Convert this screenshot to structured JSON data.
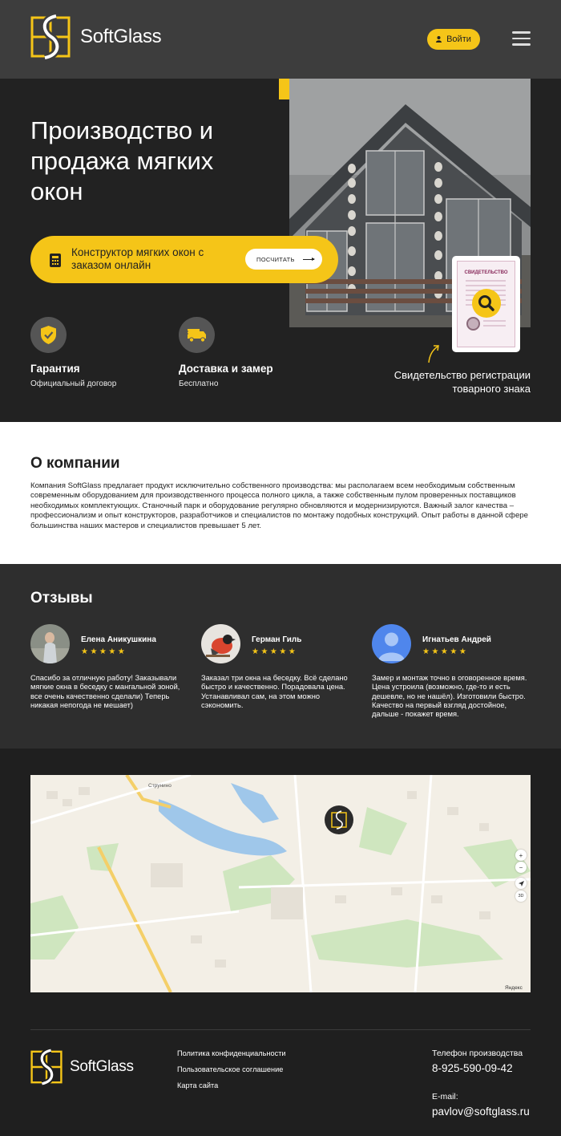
{
  "header": {
    "brand": "SoftGlass",
    "login_label": "Войти",
    "menu_icon": "hamburger-icon"
  },
  "hero": {
    "title": "Производство и продажа мягких окон",
    "cta_text": "Конструктор мягких окон с заказом онлайн",
    "cta_button": "ПОСЧИТАТЬ",
    "features": [
      {
        "name": "Гарантия",
        "sub": "Официальный договор",
        "icon": "shield-check-icon"
      },
      {
        "name": "Доставка и замер",
        "sub": "Бесплатно",
        "icon": "truck-icon"
      }
    ],
    "certificate_caption": "Свидетельство регистрации товарного знака",
    "certificate_title": "СВИДЕТЕЛЬСТВО"
  },
  "about": {
    "title": "О компании",
    "text": "Компания SoftGlass предлагает продукт исключительно собственного производства: мы располагаем всем необходимым собственным современным оборудованием для производственного процесса полного цикла, а также собственным пулом проверенных поставщиков необходимых комплектующих. Станочный парк и оборудование регулярно обновляются и модернизируются. Важный залог качества – профессионализм и опыт конструкторов, разработчиков и специалистов по монтажу подобных конструкций. Опыт работы в данной сфере большинства наших мастеров и специалистов превышает 5 лет."
  },
  "reviews": {
    "title": "Отзывы",
    "items": [
      {
        "name": "Елена Аникушкина",
        "stars": "★★★★★",
        "text": "Спасибо за отличную работу! Заказывали мягкие окна в беседку с мангальной зоной, все очень качественно сделали) Теперь никакая непогода не мешает)"
      },
      {
        "name": "Герман Гиль",
        "stars": "★★★★★",
        "text": "Заказал три окна на беседку. Всё сделано быстро и качественно. Порадовала цена. Устанавливал сам, на этом можно сэкономить."
      },
      {
        "name": "Игнатьев Андрей",
        "stars": "★★★★★",
        "text": "Замер и монтаж точно в оговоренное время. Цена устроила (возможно, где-то и есть дешевле, но не нашёл). Изготовили быстро. Качество на первый взгляд достойное, дальше - покажет время."
      }
    ]
  },
  "map": {
    "label_place": "Струнино",
    "zoom_in": "+",
    "zoom_out": "−",
    "mode_3d": "3D",
    "provider": "Яндекс"
  },
  "footer": {
    "brand": "SoftGlass",
    "links": [
      "Политика конфиденциальности",
      "Пользовательское соглашение",
      "Карта сайта"
    ],
    "phone_label": "Телефон производства",
    "phone": "8-925-590-09-42",
    "email_label": "E-mail:",
    "email": "pavlov@softglass.ru"
  },
  "colors": {
    "accent": "#f5c518",
    "header_bg": "#3d3d3d",
    "hero_bg": "#222222",
    "reviews_bg": "#2e2e2e"
  }
}
